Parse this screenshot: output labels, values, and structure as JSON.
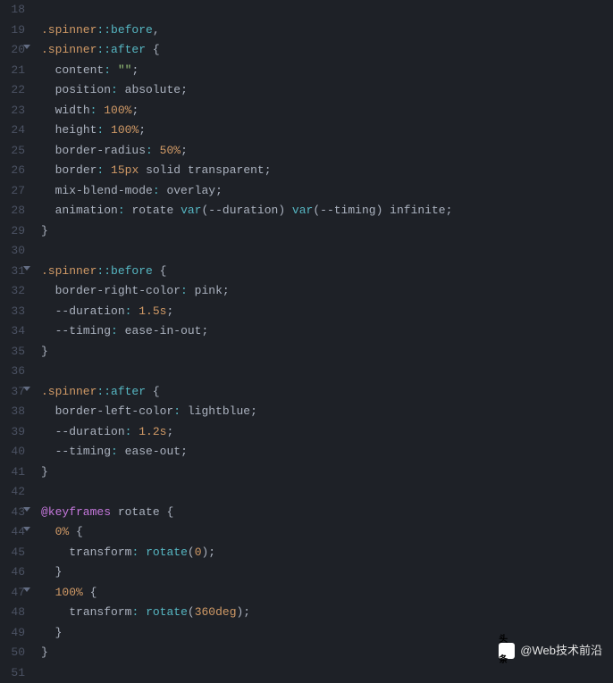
{
  "startLine": 18,
  "foldLines": [
    20,
    31,
    37,
    43,
    44,
    47
  ],
  "lines": [
    {
      "n": 18,
      "tokens": []
    },
    {
      "n": 19,
      "tokens": [
        {
          "t": "selector",
          "v": ".spinner"
        },
        {
          "t": "pseudo",
          "v": "::before"
        },
        {
          "t": "punct",
          "v": ","
        }
      ]
    },
    {
      "n": 20,
      "tokens": [
        {
          "t": "selector",
          "v": ".spinner"
        },
        {
          "t": "pseudo",
          "v": "::after"
        },
        {
          "t": "punct",
          "v": " {"
        }
      ]
    },
    {
      "n": 21,
      "tokens": [
        {
          "t": "indent",
          "v": "  "
        },
        {
          "t": "prop",
          "v": "content"
        },
        {
          "t": "colon",
          "v": ":"
        },
        {
          "t": "punct",
          "v": " "
        },
        {
          "t": "string",
          "v": "\"\""
        },
        {
          "t": "punct",
          "v": ";"
        }
      ]
    },
    {
      "n": 22,
      "tokens": [
        {
          "t": "indent",
          "v": "  "
        },
        {
          "t": "prop",
          "v": "position"
        },
        {
          "t": "colon",
          "v": ":"
        },
        {
          "t": "punct",
          "v": " "
        },
        {
          "t": "value",
          "v": "absolute"
        },
        {
          "t": "punct",
          "v": ";"
        }
      ]
    },
    {
      "n": 23,
      "tokens": [
        {
          "t": "indent",
          "v": "  "
        },
        {
          "t": "prop",
          "v": "width"
        },
        {
          "t": "colon",
          "v": ":"
        },
        {
          "t": "punct",
          "v": " "
        },
        {
          "t": "number",
          "v": "100%"
        },
        {
          "t": "punct",
          "v": ";"
        }
      ]
    },
    {
      "n": 24,
      "tokens": [
        {
          "t": "indent",
          "v": "  "
        },
        {
          "t": "prop",
          "v": "height"
        },
        {
          "t": "colon",
          "v": ":"
        },
        {
          "t": "punct",
          "v": " "
        },
        {
          "t": "number",
          "v": "100%"
        },
        {
          "t": "punct",
          "v": ";"
        }
      ]
    },
    {
      "n": 25,
      "tokens": [
        {
          "t": "indent",
          "v": "  "
        },
        {
          "t": "prop",
          "v": "border-radius"
        },
        {
          "t": "colon",
          "v": ":"
        },
        {
          "t": "punct",
          "v": " "
        },
        {
          "t": "number",
          "v": "50%"
        },
        {
          "t": "punct",
          "v": ";"
        }
      ]
    },
    {
      "n": 26,
      "tokens": [
        {
          "t": "indent",
          "v": "  "
        },
        {
          "t": "prop",
          "v": "border"
        },
        {
          "t": "colon",
          "v": ":"
        },
        {
          "t": "punct",
          "v": " "
        },
        {
          "t": "number",
          "v": "15px"
        },
        {
          "t": "punct",
          "v": " "
        },
        {
          "t": "value",
          "v": "solid"
        },
        {
          "t": "punct",
          "v": " "
        },
        {
          "t": "value",
          "v": "transparent"
        },
        {
          "t": "punct",
          "v": ";"
        }
      ]
    },
    {
      "n": 27,
      "tokens": [
        {
          "t": "indent",
          "v": "  "
        },
        {
          "t": "prop",
          "v": "mix-blend-mode"
        },
        {
          "t": "colon",
          "v": ":"
        },
        {
          "t": "punct",
          "v": " "
        },
        {
          "t": "value",
          "v": "overlay"
        },
        {
          "t": "punct",
          "v": ";"
        }
      ]
    },
    {
      "n": 28,
      "tokens": [
        {
          "t": "indent",
          "v": "  "
        },
        {
          "t": "prop",
          "v": "animation"
        },
        {
          "t": "colon",
          "v": ":"
        },
        {
          "t": "punct",
          "v": " "
        },
        {
          "t": "value",
          "v": "rotate"
        },
        {
          "t": "punct",
          "v": " "
        },
        {
          "t": "func",
          "v": "var"
        },
        {
          "t": "punct",
          "v": "("
        },
        {
          "t": "var",
          "v": "--duration"
        },
        {
          "t": "punct",
          "v": ") "
        },
        {
          "t": "func",
          "v": "var"
        },
        {
          "t": "punct",
          "v": "("
        },
        {
          "t": "var",
          "v": "--timing"
        },
        {
          "t": "punct",
          "v": ") "
        },
        {
          "t": "value",
          "v": "infinite"
        },
        {
          "t": "punct",
          "v": ";"
        }
      ]
    },
    {
      "n": 29,
      "tokens": [
        {
          "t": "punct",
          "v": "}"
        }
      ]
    },
    {
      "n": 30,
      "tokens": []
    },
    {
      "n": 31,
      "tokens": [
        {
          "t": "selector",
          "v": ".spinner"
        },
        {
          "t": "pseudo",
          "v": "::before"
        },
        {
          "t": "punct",
          "v": " {"
        }
      ]
    },
    {
      "n": 32,
      "tokens": [
        {
          "t": "indent",
          "v": "  "
        },
        {
          "t": "prop",
          "v": "border-right-color"
        },
        {
          "t": "colon",
          "v": ":"
        },
        {
          "t": "punct",
          "v": " "
        },
        {
          "t": "value",
          "v": "pink"
        },
        {
          "t": "punct",
          "v": ";"
        }
      ]
    },
    {
      "n": 33,
      "tokens": [
        {
          "t": "indent",
          "v": "  "
        },
        {
          "t": "prop",
          "v": "--duration"
        },
        {
          "t": "colon",
          "v": ":"
        },
        {
          "t": "punct",
          "v": " "
        },
        {
          "t": "number",
          "v": "1.5s"
        },
        {
          "t": "punct",
          "v": ";"
        }
      ]
    },
    {
      "n": 34,
      "tokens": [
        {
          "t": "indent",
          "v": "  "
        },
        {
          "t": "prop",
          "v": "--timing"
        },
        {
          "t": "colon",
          "v": ":"
        },
        {
          "t": "punct",
          "v": " "
        },
        {
          "t": "value",
          "v": "ease-in-out"
        },
        {
          "t": "punct",
          "v": ";"
        }
      ]
    },
    {
      "n": 35,
      "tokens": [
        {
          "t": "punct",
          "v": "}"
        }
      ]
    },
    {
      "n": 36,
      "tokens": []
    },
    {
      "n": 37,
      "tokens": [
        {
          "t": "selector",
          "v": ".spinner"
        },
        {
          "t": "pseudo",
          "v": "::after"
        },
        {
          "t": "punct",
          "v": " {"
        }
      ]
    },
    {
      "n": 38,
      "tokens": [
        {
          "t": "indent",
          "v": "  "
        },
        {
          "t": "prop",
          "v": "border-left-color"
        },
        {
          "t": "colon",
          "v": ":"
        },
        {
          "t": "punct",
          "v": " "
        },
        {
          "t": "value",
          "v": "lightblue"
        },
        {
          "t": "punct",
          "v": ";"
        }
      ]
    },
    {
      "n": 39,
      "tokens": [
        {
          "t": "indent",
          "v": "  "
        },
        {
          "t": "prop",
          "v": "--duration"
        },
        {
          "t": "colon",
          "v": ":"
        },
        {
          "t": "punct",
          "v": " "
        },
        {
          "t": "number",
          "v": "1.2s"
        },
        {
          "t": "punct",
          "v": ";"
        }
      ]
    },
    {
      "n": 40,
      "tokens": [
        {
          "t": "indent",
          "v": "  "
        },
        {
          "t": "prop",
          "v": "--timing"
        },
        {
          "t": "colon",
          "v": ":"
        },
        {
          "t": "punct",
          "v": " "
        },
        {
          "t": "value",
          "v": "ease-out"
        },
        {
          "t": "punct",
          "v": ";"
        }
      ]
    },
    {
      "n": 41,
      "tokens": [
        {
          "t": "punct",
          "v": "}"
        }
      ]
    },
    {
      "n": 42,
      "tokens": []
    },
    {
      "n": 43,
      "tokens": [
        {
          "t": "at",
          "v": "@keyframes"
        },
        {
          "t": "punct",
          "v": " "
        },
        {
          "t": "atname",
          "v": "rotate"
        },
        {
          "t": "punct",
          "v": " {"
        }
      ]
    },
    {
      "n": 44,
      "tokens": [
        {
          "t": "indent",
          "v": "  "
        },
        {
          "t": "number",
          "v": "0%"
        },
        {
          "t": "punct",
          "v": " {"
        }
      ]
    },
    {
      "n": 45,
      "tokens": [
        {
          "t": "indent",
          "v": "    "
        },
        {
          "t": "prop",
          "v": "transform"
        },
        {
          "t": "colon",
          "v": ":"
        },
        {
          "t": "punct",
          "v": " "
        },
        {
          "t": "func",
          "v": "rotate"
        },
        {
          "t": "punct",
          "v": "("
        },
        {
          "t": "number",
          "v": "0"
        },
        {
          "t": "punct",
          "v": ");"
        }
      ]
    },
    {
      "n": 46,
      "tokens": [
        {
          "t": "indent",
          "v": "  "
        },
        {
          "t": "punct",
          "v": "}"
        }
      ]
    },
    {
      "n": 47,
      "tokens": [
        {
          "t": "indent",
          "v": "  "
        },
        {
          "t": "number",
          "v": "100%"
        },
        {
          "t": "punct",
          "v": " {"
        }
      ]
    },
    {
      "n": 48,
      "tokens": [
        {
          "t": "indent",
          "v": "    "
        },
        {
          "t": "prop",
          "v": "transform"
        },
        {
          "t": "colon",
          "v": ":"
        },
        {
          "t": "punct",
          "v": " "
        },
        {
          "t": "func",
          "v": "rotate"
        },
        {
          "t": "punct",
          "v": "("
        },
        {
          "t": "number",
          "v": "360deg"
        },
        {
          "t": "punct",
          "v": ");"
        }
      ]
    },
    {
      "n": 49,
      "tokens": [
        {
          "t": "indent",
          "v": "  "
        },
        {
          "t": "punct",
          "v": "}"
        }
      ]
    },
    {
      "n": 50,
      "tokens": [
        {
          "t": "punct",
          "v": "}"
        }
      ]
    },
    {
      "n": 51,
      "tokens": []
    }
  ],
  "watermark": {
    "icon": "头条",
    "text": "@Web技术前沿"
  }
}
